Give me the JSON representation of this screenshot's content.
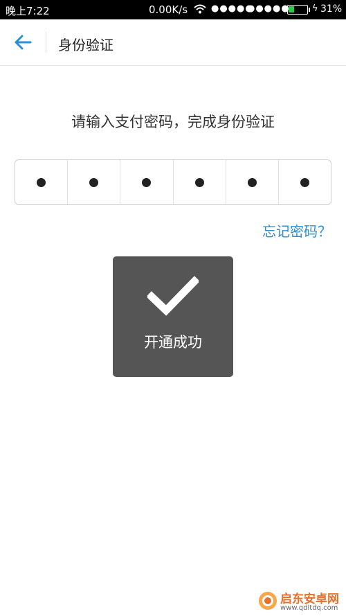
{
  "status_bar": {
    "time": "晚上7:22",
    "speed": "0.00K/s",
    "signal_1": "●●●●●",
    "signal_2": "●●●●●",
    "battery_percent": "31%",
    "battery_level": 0.31,
    "charging_icon": "bolt-icon"
  },
  "nav": {
    "back_icon": "arrow-left-icon",
    "title": "身份验证"
  },
  "prompt": "请输入支付密码，完成身份验证",
  "pin": {
    "length": 6,
    "filled": 6
  },
  "forgot_link": "忘记密码？",
  "toast": {
    "icon": "checkmark-icon",
    "message": "开通成功"
  },
  "watermark": {
    "brand": "启东安卓网",
    "url": "www.qdltdq.com"
  },
  "colors": {
    "accent": "#2a8fd6",
    "toast_bg": "#555555",
    "status_bar_bg": "#000000"
  }
}
